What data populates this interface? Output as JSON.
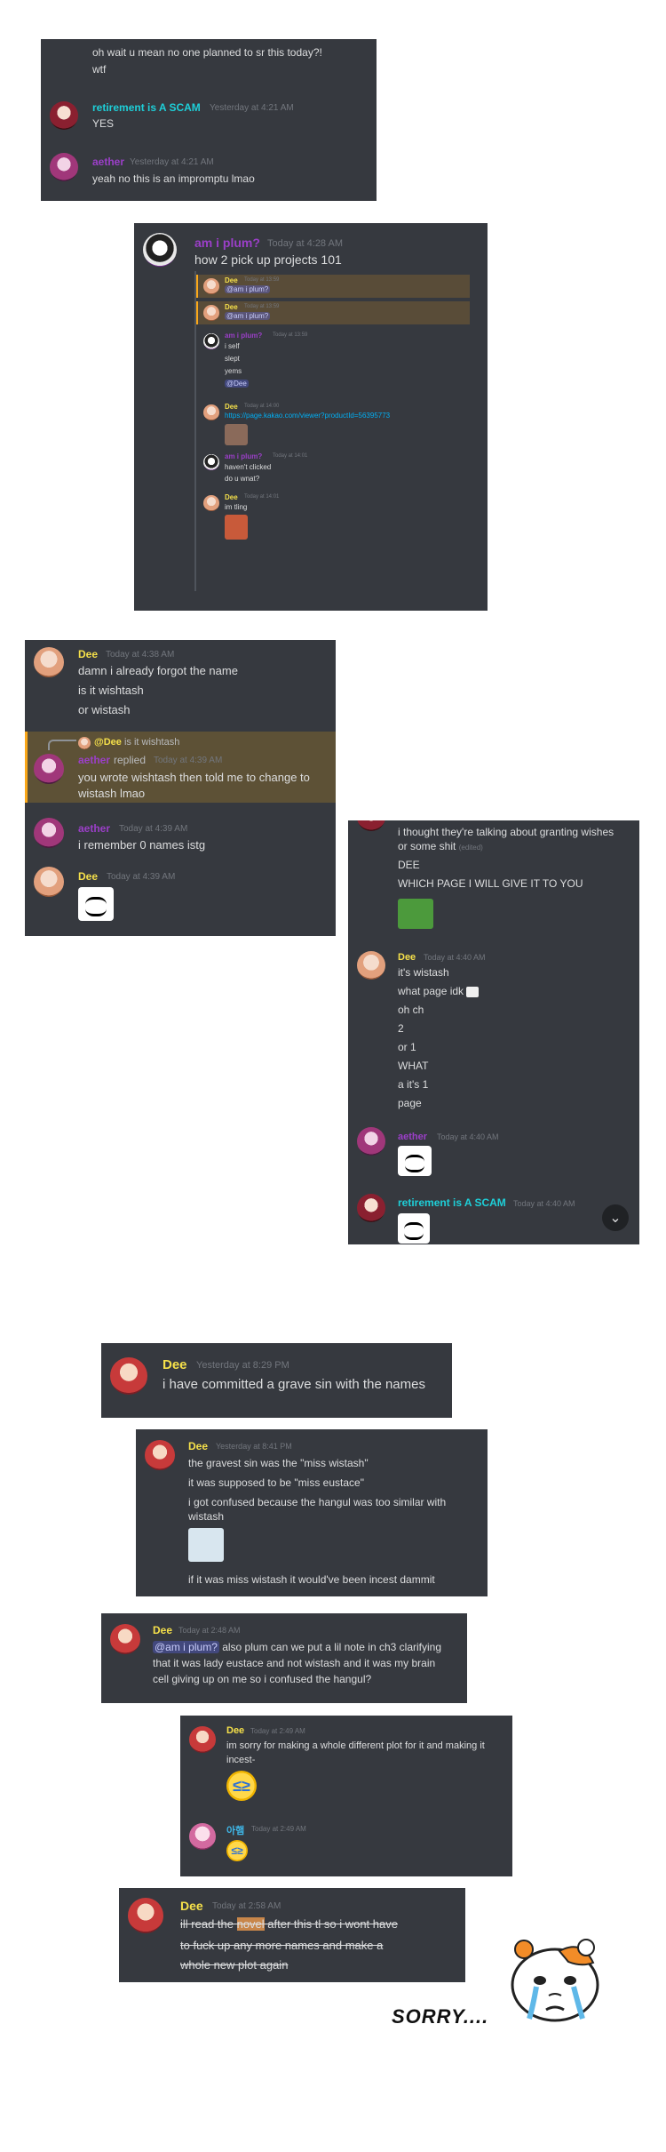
{
  "panel1": {
    "top_lines": [
      "oh wait u mean no one planned to sr this today?!",
      "wtf"
    ],
    "msg1": {
      "author": "retirement is A SCAM",
      "time": "Yesterday at 4:21 AM",
      "text": "YES"
    },
    "msg2": {
      "author": "aether",
      "time": "Yesterday at 4:21 AM",
      "text": "yeah no this is an impromptu lmao"
    }
  },
  "panel2": {
    "author": "am i plum?",
    "time": "Today at 4:28 AM",
    "text": "how 2 pick up projects 101",
    "embed": {
      "e1": {
        "author": "Dee",
        "time": "Today at 13:59",
        "text": "@am i plum?"
      },
      "e2": {
        "author": "Dee",
        "time": "Today at 13:59",
        "text": "@am i plum?"
      },
      "e3": {
        "author": "am i plum?",
        "time": "Today at 13:59",
        "lines": [
          "i self",
          "slept",
          "yems",
          "@Dee"
        ]
      },
      "e4": {
        "author": "Dee",
        "time": "Today at 14:00",
        "link": "https://page.kakao.com/viewer?productId=56395773"
      },
      "e5": {
        "author": "am i plum?",
        "time": "Today at 14:01",
        "lines": [
          "haven't clicked",
          "do u wnat?"
        ]
      },
      "e6": {
        "author": "Dee",
        "time": "Today at 14:01",
        "text": "im tling"
      }
    }
  },
  "panel3": {
    "m1": {
      "author": "Dee",
      "time": "Today at 4:38 AM",
      "lines": [
        "damn i already forgot the name",
        "is it wishtash",
        "or wistash"
      ]
    },
    "reply_ref": {
      "author": "@Dee",
      "text": "is it wishtash"
    },
    "m2": {
      "author": "aether",
      "replied": "replied",
      "time": "Today at 4:39 AM",
      "lines": [
        "you wrote wishtash then told me to change to",
        "wistash lmao"
      ]
    },
    "m3": {
      "author": "aether",
      "time": "Today at 4:39 AM",
      "text": "i remember 0 names istg"
    },
    "m4": {
      "author": "Dee",
      "time": "Today at 4:39 AM"
    }
  },
  "panel4": {
    "top_lines": [
      "i thought they're talking about granting wishes",
      "or some shit"
    ],
    "edited": "(edited)",
    "lines_after": [
      "DEE",
      "WHICH PAGE I WILL GIVE IT TO YOU"
    ],
    "m1": {
      "author": "Dee",
      "time": "Today at 4:40 AM",
      "lines": [
        "it's wistash",
        "what page idk",
        "oh ch",
        "2",
        "or 1",
        "WHAT",
        "a it's 1",
        "page"
      ]
    },
    "m2": {
      "author": "aether",
      "time": "Today at 4:40 AM"
    },
    "m3": {
      "author": "retirement is A SCAM",
      "time": "Today at 4:40 AM"
    }
  },
  "panel5": {
    "author": "Dee",
    "time": "Yesterday at 8:29 PM",
    "text": "i have committed a grave sin with the names"
  },
  "panel6": {
    "author": "Dee",
    "time": "Yesterday at 8:41 PM",
    "lines": [
      "the gravest sin was the \"miss wistash\"",
      "it was supposed to be \"miss eustace\"",
      "i got confused because the hangul was too similar with",
      "wistash"
    ],
    "last": "if it was miss wistash it would've been incest dammit"
  },
  "panel7": {
    "author": "Dee",
    "time": "Today at 2:48 AM",
    "mention": "@am i plum?",
    "line1": " also plum can we put a lil note in ch3 clarifying",
    "line2": "that it was lady eustace and not wistash and it was my brain",
    "line3": "cell giving up on me so i confused the hangul?"
  },
  "panel8": {
    "m1": {
      "author": "Dee",
      "time": "Today at 2:49 AM",
      "lines": [
        "im sorry for making a whole different plot for it and making it",
        "incest-"
      ]
    },
    "m2": {
      "author": "아햄",
      "time": "Today at 2:49 AM"
    }
  },
  "panel9": {
    "author": "Dee",
    "time": "Today at 2:58 AM",
    "l1a": "ill read the ",
    "l1b": "novel",
    "l1c": " after this tl so i wont have",
    "l2": "to fuck up any more names and make a",
    "l3": "whole new plot again"
  },
  "sorry": "SORRY....",
  "colors": {
    "panel_bg": "#36393f",
    "dee": "#f5e04a",
    "retirement": "#1ecfd8",
    "aether": "#9b3fc8",
    "plum": "#9b3fc8",
    "aham": "#3fb7e8"
  }
}
